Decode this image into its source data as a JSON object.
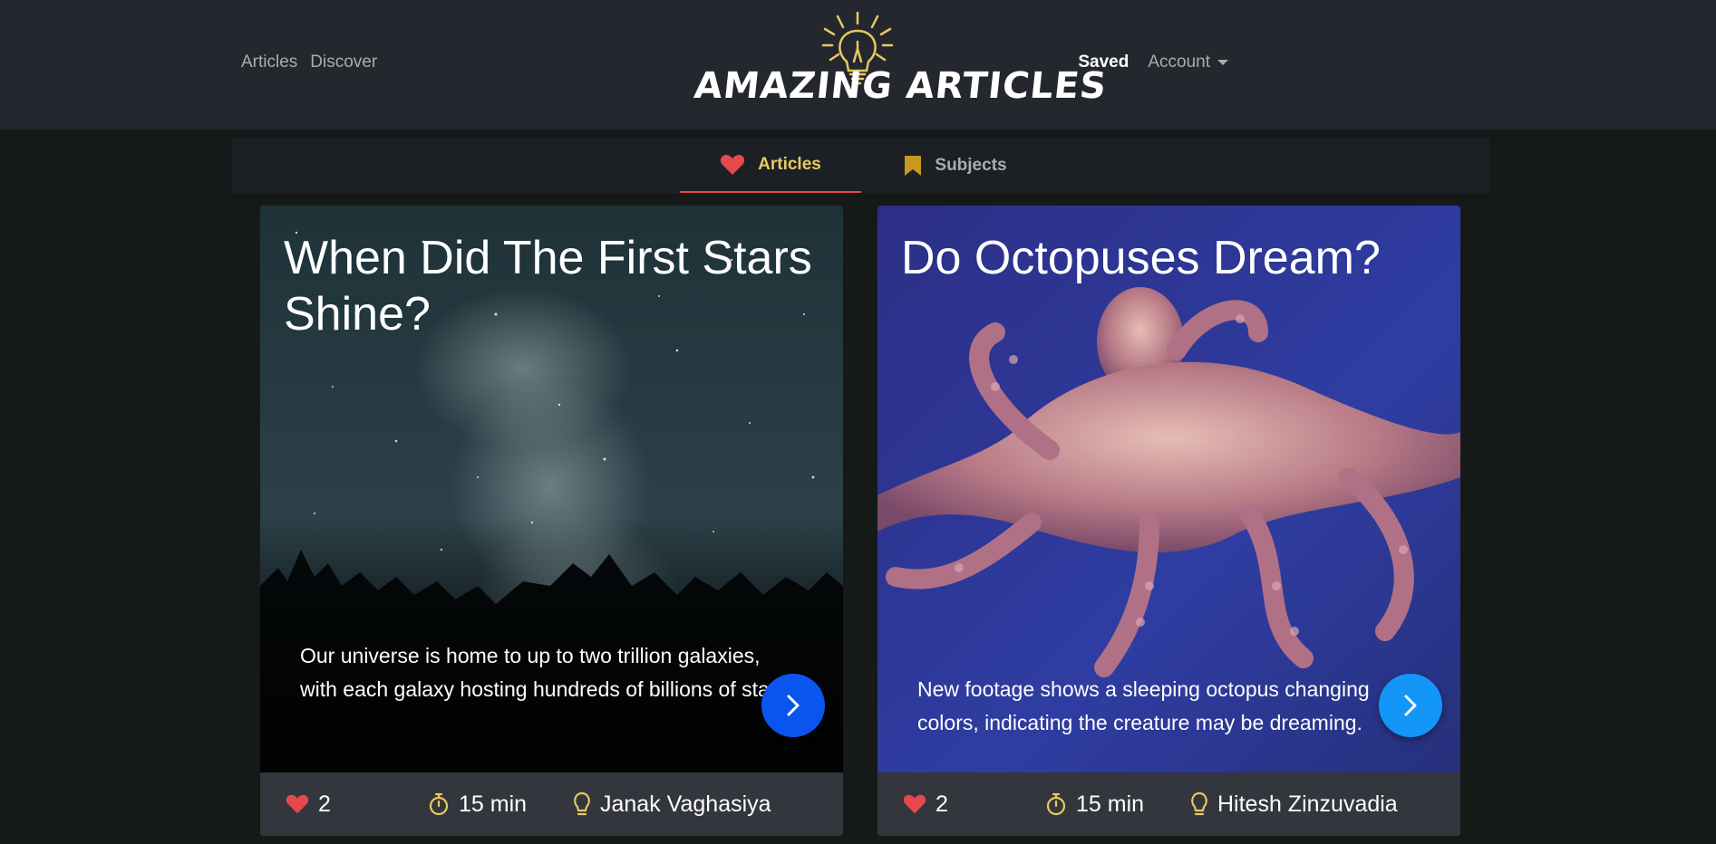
{
  "nav": {
    "left_links": [
      "Articles",
      "Discover"
    ],
    "saved_label": "Saved",
    "account_label": "Account"
  },
  "logo": {
    "text": "AMAZING ARTICLES"
  },
  "tabs": [
    {
      "label": "Articles",
      "icon": "heart-icon",
      "active": true
    },
    {
      "label": "Subjects",
      "icon": "bookmark-icon",
      "active": false
    }
  ],
  "colors": {
    "accent_gold": "#e7c963",
    "heart_red": "#e5484d",
    "card_btn_1": "#0a55f0",
    "card_btn_2": "#1296f7"
  },
  "cards": [
    {
      "title": "When Did The First Stars Shine?",
      "description": "Our universe is home to up to two trillion galaxies, with each galaxy hosting hundreds of billions of stars.",
      "likes": "2",
      "time": "15 min",
      "author": "Janak Vaghasiya",
      "image": "night-sky-milky-way"
    },
    {
      "title": "Do Octopuses Dream?",
      "description": "New footage shows a sleeping octopus changing colors, indicating the creature may be dreaming.",
      "likes": "2",
      "time": "15 min",
      "author": "Hitesh Zinzuvadia",
      "image": "octopus-underwater"
    }
  ]
}
